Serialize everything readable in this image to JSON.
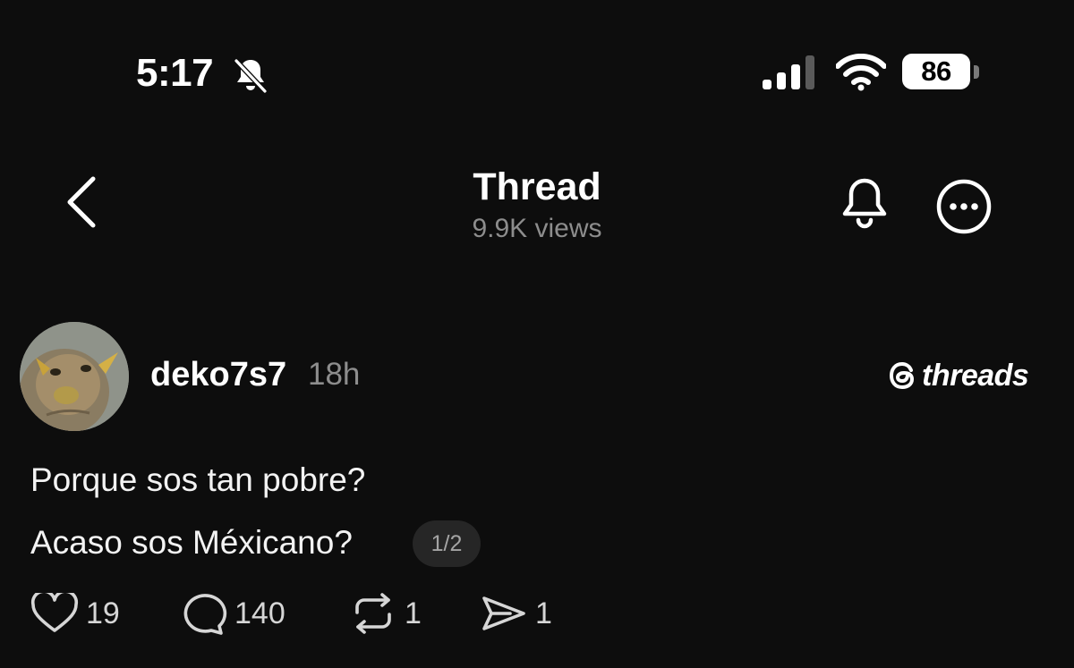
{
  "status_bar": {
    "time": "5:17",
    "battery": "86",
    "icons": [
      "bell-slash-icon",
      "cellular-signal-icon",
      "wifi-icon",
      "battery-icon"
    ]
  },
  "header": {
    "title": "Thread",
    "views": "9.9K views",
    "icons": [
      "back-chevron-icon",
      "bell-icon",
      "more-options-icon"
    ]
  },
  "post": {
    "username": "deko7s7",
    "time_ago": "18h",
    "brand": "threads",
    "text_lines": [
      "Porque sos tan pobre?",
      "Acaso sos Méxicano?"
    ],
    "pager": "1/2",
    "actions": {
      "likes": "19",
      "replies": "140",
      "reposts": "1",
      "shares": "1"
    }
  },
  "colors": {
    "background": "#0d0d0d",
    "text_primary": "#f3f3f3",
    "text_secondary": "#8d8d8d",
    "pager_bg": "#262626"
  }
}
